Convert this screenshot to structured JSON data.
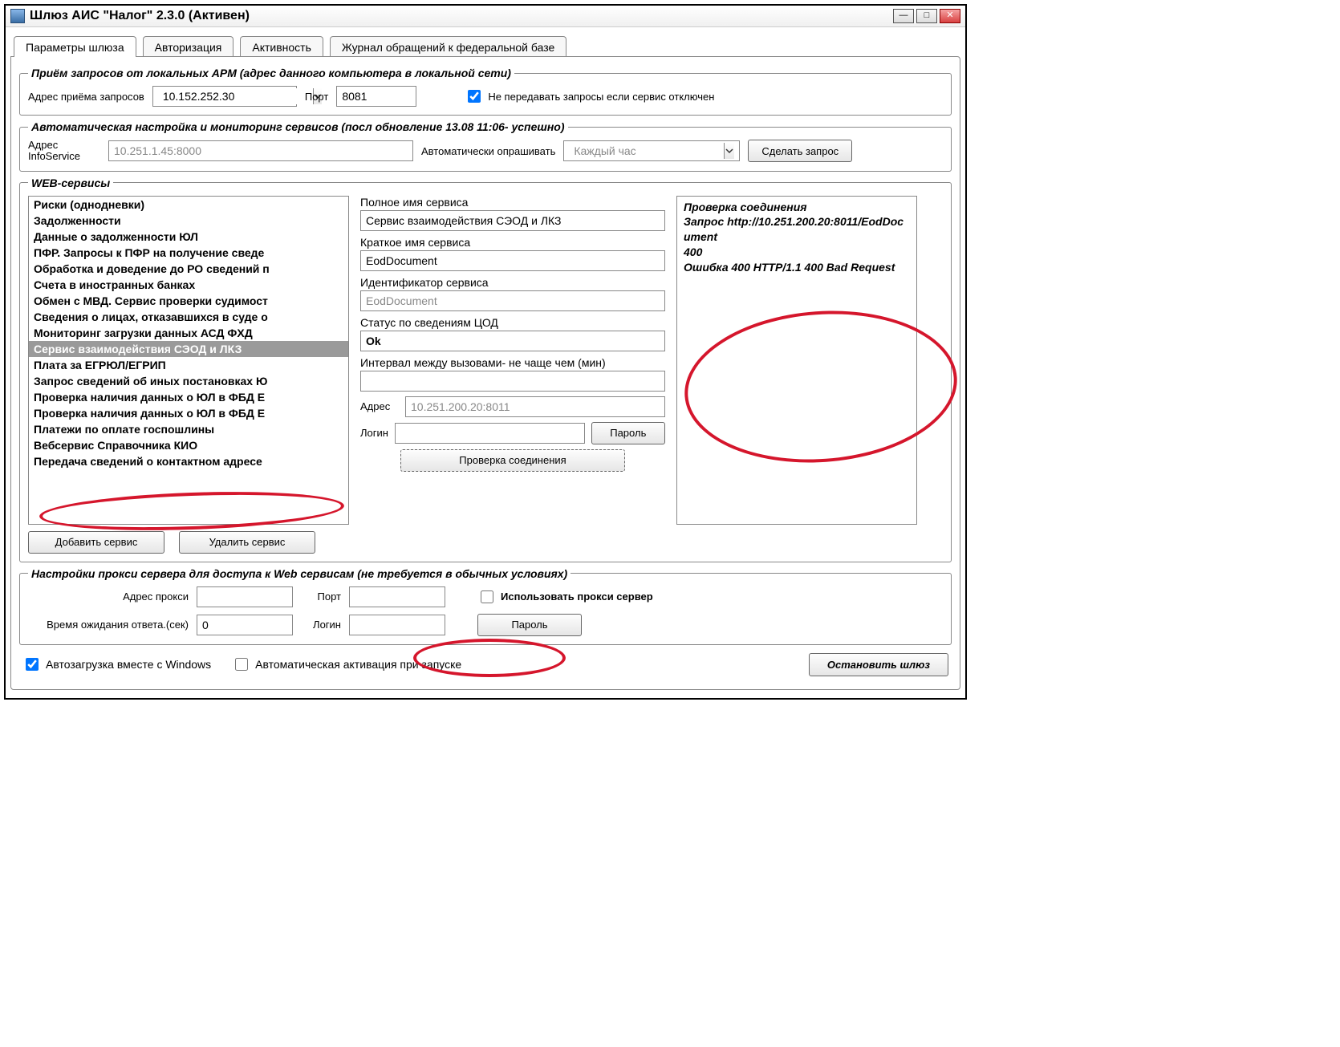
{
  "title": "Шлюз АИС \"Налог\" 2.3.0 (Активен)",
  "tabs": {
    "t0": "Параметры шлюза",
    "t1": "Авторизация",
    "t2": "Активность",
    "t3": "Журнал обращений к федеральной базе"
  },
  "recv": {
    "legend": "Приём запросов от локальных АРМ (адрес данного компьютера в локальной сети)",
    "addr_label": "Адрес приёма запросов",
    "addr_value": "10.152.252.30",
    "port_label": "Порт",
    "port_value": "8081",
    "noforward_label": "Не передавать запросы если сервис отключен"
  },
  "auto": {
    "legend": "Автоматическая настройка и мониторинг сервисов (посл обновление  13.08 11:06- успешно)",
    "addr_label": "Адрес InfoService",
    "addr_value": "10.251.1.45:8000",
    "poll_label": "Автоматически опрашивать",
    "poll_value": "Каждый час",
    "btn": "Сделать запрос"
  },
  "web": {
    "legend": "WEB-сервисы",
    "items": [
      "Риски (однодневки)",
      "Задолженности",
      "Данные о задолженности ЮЛ",
      "ПФР. Запросы к ПФР на получение сведе",
      "Обработка и доведение до РО сведений п",
      "Счета в иностранных банках",
      "Обмен с МВД. Сервис проверки судимост",
      "Сведения о лицах, отказавшихся в суде о",
      "Мониторинг загрузки данных АСД ФХД",
      "Сервис взаимодействия СЭОД и ЛКЗ",
      "Плата за ЕГРЮЛ/ЕГРИП",
      "Запрос сведений об иных постановках Ю",
      "Проверка наличия данных о ЮЛ в ФБД Е",
      "Проверка наличия данных о ЮЛ в ФБД Е",
      "Платежи по оплате госпошлины",
      "Вебсервис Справочника КИО",
      "Передача сведений о контактном адресе"
    ],
    "selected_index": 9,
    "add_btn": "Добавить сервис",
    "del_btn": "Удалить сервис",
    "svc": {
      "full_label": "Полное имя сервиса",
      "full_value": "Сервис взаимодействия СЭОД и ЛКЗ",
      "short_label": "Краткое имя сервиса",
      "short_value": "EodDocument",
      "id_label": "Идентификатор сервиса",
      "id_value": "EodDocument",
      "status_label": "Статус по сведениям ЦОД",
      "status_value": "Ok",
      "interval_label": "Интервал между вызовами- не чаще чем (мин)",
      "interval_value": "",
      "addr_label": "Адрес",
      "addr_value": "10.251.200.20:8011",
      "login_label": "Логин",
      "login_value": "",
      "pwd_btn": "Пароль",
      "check_btn": "Проверка соединения"
    },
    "log": "Проверка соединения\nЗапрос http://10.251.200.20:8011/EodDocument\n400\nОшибка 400 HTTP/1.1 400 Bad Request"
  },
  "proxy": {
    "legend": "Настройки прокси сервера для доступа к Web сервисам (не требуется в обычных условиях)",
    "addr_label": "Адрес прокси",
    "addr_value": "",
    "port_label": "Порт",
    "port_value": "",
    "use_label": "Использовать прокси сервер",
    "timeout_label": "Время ожидания ответа.(сек)",
    "timeout_value": "0",
    "login_label": "Логин",
    "login_value": "",
    "pwd_btn": "Пароль"
  },
  "footer": {
    "autostart": "Автозагрузка вместе с Windows",
    "autoactivate": "Автоматическая активация при запуске",
    "stop_btn": "Остановить шлюз"
  }
}
